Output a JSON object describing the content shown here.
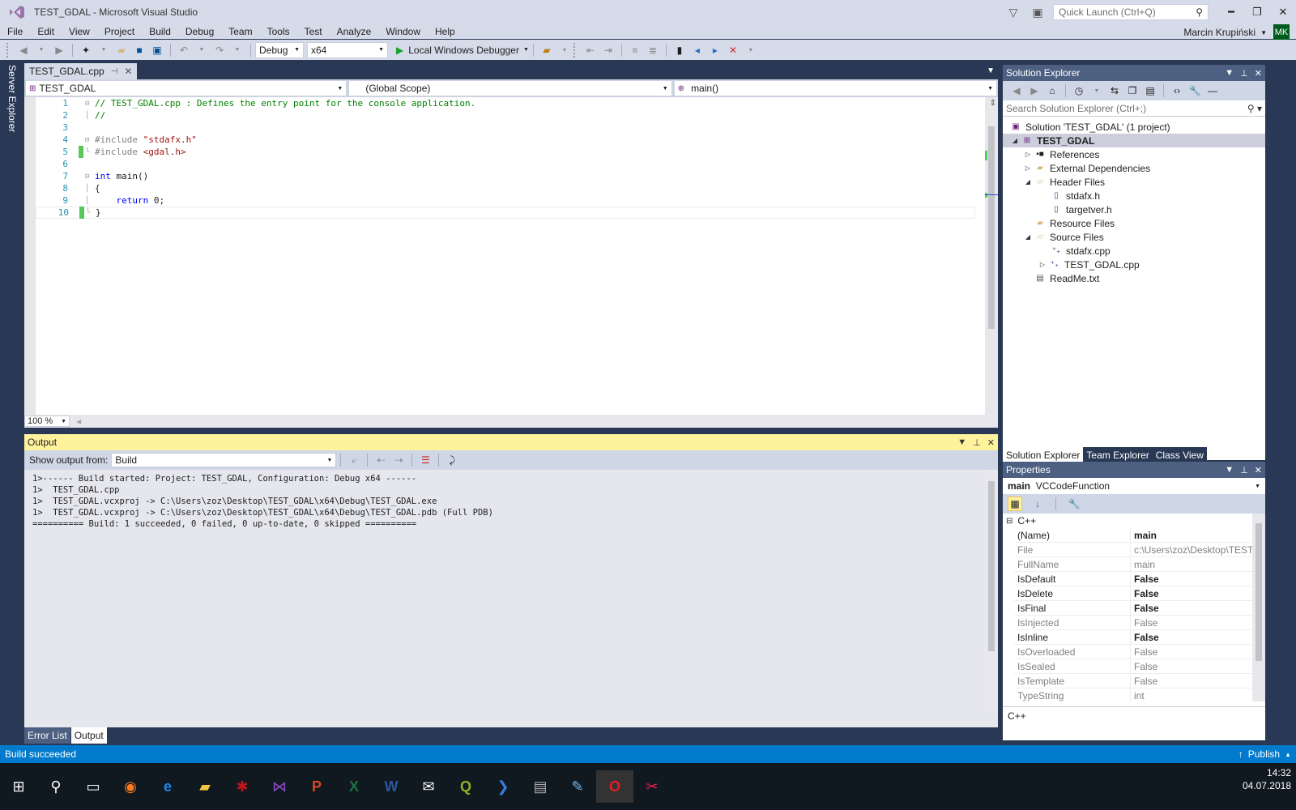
{
  "window": {
    "title": "TEST_GDAL - Microsoft Visual Studio",
    "quick_launch_placeholder": "Quick Launch (Ctrl+Q)",
    "user_name": "Marcin Krupiński",
    "user_initials": "MK"
  },
  "menu": [
    "File",
    "Edit",
    "View",
    "Project",
    "Build",
    "Debug",
    "Team",
    "Tools",
    "Test",
    "Analyze",
    "Window",
    "Help"
  ],
  "toolbar": {
    "configuration": "Debug",
    "platform": "x64",
    "run_label": "Local Windows Debugger"
  },
  "side_tab": "Server Explorer",
  "editor": {
    "tab_label": "TEST_GDAL.cpp",
    "nav_project": "TEST_GDAL",
    "nav_scope": "(Global Scope)",
    "nav_member": "main()",
    "zoom": "100 %",
    "lines": [
      {
        "n": "1",
        "text": "// TEST_GDAL.cpp : Defines the entry point for the console application."
      },
      {
        "n": "2",
        "text": "//"
      },
      {
        "n": "3",
        "text": ""
      },
      {
        "n": "4",
        "text": "#include \"stdafx.h\""
      },
      {
        "n": "5",
        "text": "#include <gdal.h>"
      },
      {
        "n": "6",
        "text": ""
      },
      {
        "n": "7",
        "text": "int main()"
      },
      {
        "n": "8",
        "text": "{"
      },
      {
        "n": "9",
        "text": "    return 0;"
      },
      {
        "n": "10",
        "text": "}"
      }
    ]
  },
  "output": {
    "title": "Output",
    "show_from_label": "Show output from:",
    "source": "Build",
    "lines": [
      "1>------ Build started: Project: TEST_GDAL, Configuration: Debug x64 ------",
      "1>  TEST_GDAL.cpp",
      "1>  TEST_GDAL.vcxproj -> C:\\Users\\zoz\\Desktop\\TEST_GDAL\\x64\\Debug\\TEST_GDAL.exe",
      "1>  TEST_GDAL.vcxproj -> C:\\Users\\zoz\\Desktop\\TEST_GDAL\\x64\\Debug\\TEST_GDAL.pdb (Full PDB)",
      "========== Build: 1 succeeded, 0 failed, 0 up-to-date, 0 skipped =========="
    ],
    "tabs": [
      "Error List",
      "Output"
    ]
  },
  "solution_explorer": {
    "title": "Solution Explorer",
    "search_placeholder": "Search Solution Explorer (Ctrl+;)",
    "tree": [
      {
        "label": "Solution 'TEST_GDAL' (1 project)",
        "icon": "solution-icon"
      },
      {
        "label": "TEST_GDAL",
        "icon": "project-icon"
      },
      {
        "label": "References",
        "icon": "references-icon"
      },
      {
        "label": "External Dependencies",
        "icon": "folder-icon"
      },
      {
        "label": "Header Files",
        "icon": "filter-folder-icon"
      },
      {
        "label": "stdafx.h",
        "icon": "header-file-icon"
      },
      {
        "label": "targetver.h",
        "icon": "header-file-icon"
      },
      {
        "label": "Resource Files",
        "icon": "filter-folder-icon"
      },
      {
        "label": "Source Files",
        "icon": "filter-folder-icon"
      },
      {
        "label": "stdafx.cpp",
        "icon": "cpp-file-icon"
      },
      {
        "label": "TEST_GDAL.cpp",
        "icon": "cpp-file-icon"
      },
      {
        "label": "ReadMe.txt",
        "icon": "text-file-icon"
      }
    ],
    "tabs": [
      "Solution Explorer",
      "Team Explorer",
      "Class View"
    ]
  },
  "properties": {
    "title": "Properties",
    "object_name": "main",
    "object_type": "VCCodeFunction",
    "category": "C++",
    "rows": [
      {
        "key": "(Name)",
        "value": "main"
      },
      {
        "key": "File",
        "value": "c:\\Users\\zoz\\Desktop\\TEST_"
      },
      {
        "key": "FullName",
        "value": "main"
      },
      {
        "key": "IsDefault",
        "value": "False"
      },
      {
        "key": "IsDelete",
        "value": "False"
      },
      {
        "key": "IsFinal",
        "value": "False"
      },
      {
        "key": "IsInjected",
        "value": "False"
      },
      {
        "key": "IsInline",
        "value": "False"
      },
      {
        "key": "IsOverloaded",
        "value": "False"
      },
      {
        "key": "IsSealed",
        "value": "False"
      },
      {
        "key": "IsTemplate",
        "value": "False"
      },
      {
        "key": "TypeString",
        "value": "int"
      }
    ],
    "description": "C++"
  },
  "status": {
    "text": "Build succeeded",
    "publish": "Publish"
  },
  "taskbar": {
    "time": "14:32",
    "date": "04.07.2018"
  }
}
